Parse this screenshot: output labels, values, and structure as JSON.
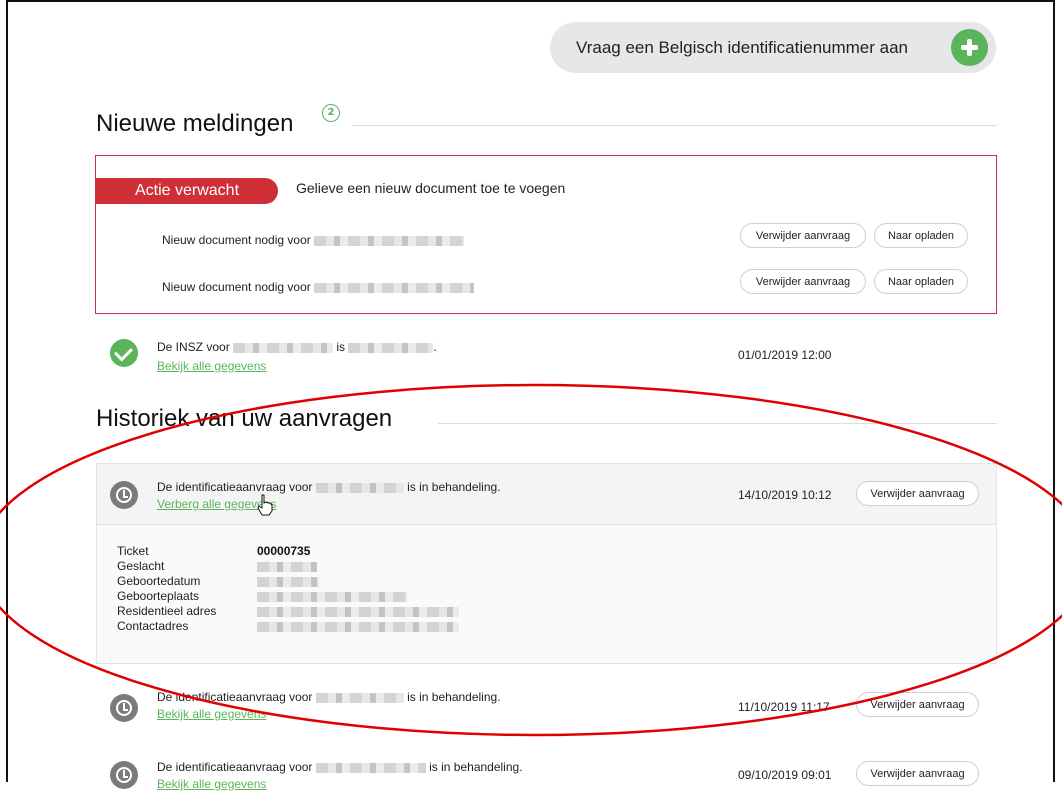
{
  "header": {
    "request_button_label": "Vraag een Belgisch identificatienummer aan",
    "request_button_icon": "plus-icon"
  },
  "notifications": {
    "title": "Nieuwe meldingen",
    "count": "2",
    "action_box": {
      "tag": "Actie verwacht",
      "description": "Gelieve een nieuw document toe te voegen",
      "rows": [
        {
          "text": "Nieuw document nodig voor",
          "delete_label": "Verwijder aanvraag",
          "upload_label": "Naar opladen"
        },
        {
          "text": "Nieuw document nodig voor",
          "delete_label": "Verwijder aanvraag",
          "upload_label": "Naar opladen"
        }
      ]
    },
    "insz": {
      "text_prefix": "De INSZ voor",
      "text_mid": "is",
      "text_suffix": ".",
      "link": "Bekijk alle gegevens",
      "date": "01/01/2019 12:00"
    }
  },
  "history": {
    "title": "Historiek van uw aanvragen",
    "items": [
      {
        "text_prefix": "De identificatieaanvraag voor",
        "text_suffix": "is in behandeling.",
        "link": "Verberg alle gegevens",
        "date": "14/10/2019 10:12",
        "delete_label": "Verwijder aanvraag",
        "details": [
          {
            "key": "Ticket",
            "value": "00000735"
          },
          {
            "key": "Geslacht",
            "value": ""
          },
          {
            "key": "Geboortedatum",
            "value": ""
          },
          {
            "key": "Geboorteplaats",
            "value": ""
          },
          {
            "key": "Residentieel adres",
            "value": ""
          },
          {
            "key": "Contactadres",
            "value": ""
          }
        ]
      },
      {
        "text_prefix": "De identificatieaanvraag voor",
        "text_suffix": "is in behandeling.",
        "link": "Bekijk alle gegevens",
        "date": "11/10/2019 11:17",
        "delete_label": "Verwijder aanvraag"
      },
      {
        "text_prefix": "De identificatieaanvraag voor",
        "text_suffix": "is in behandeling.",
        "link": "Bekijk alle gegevens",
        "date": "09/10/2019 09:01",
        "delete_label": "Verwijder aanvraag"
      }
    ]
  },
  "colors": {
    "accent_green": "#5ab55a",
    "alert_red": "#cf2f37",
    "annotation_red": "#e00000"
  }
}
